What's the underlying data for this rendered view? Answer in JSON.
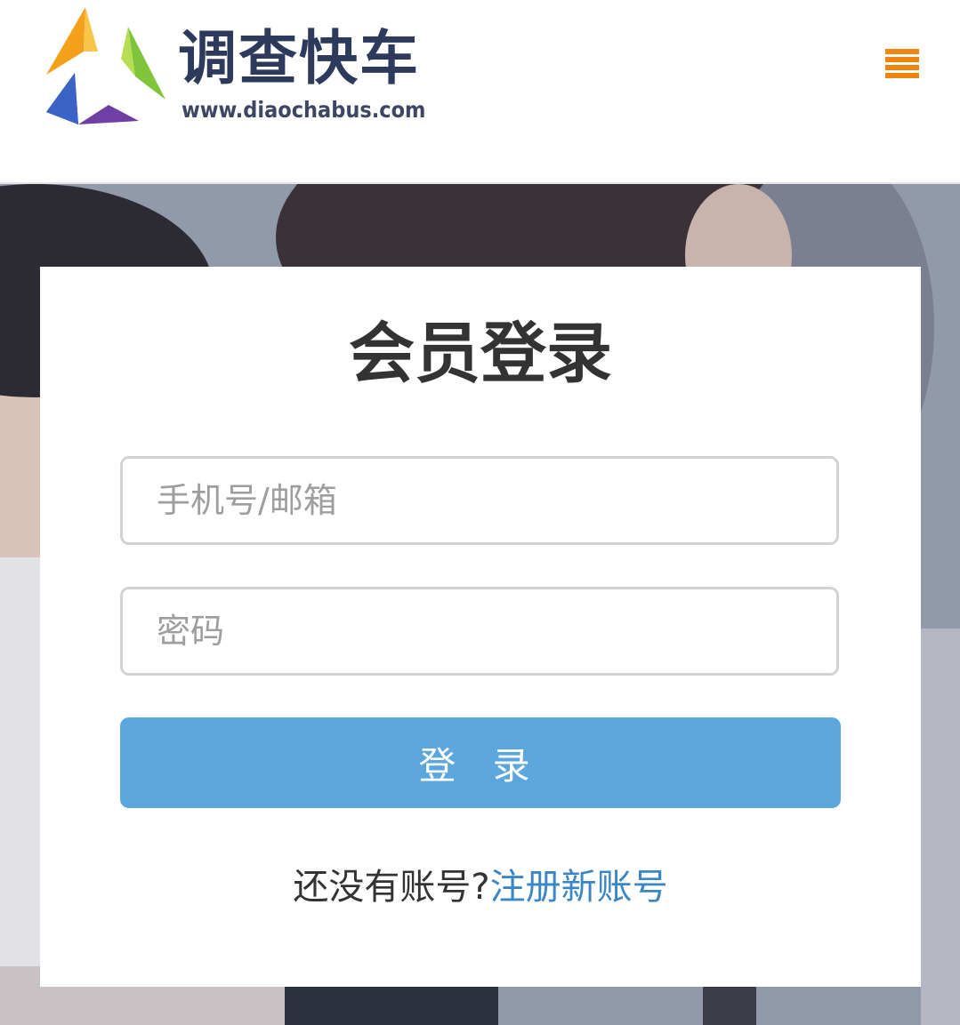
{
  "header": {
    "logo_title": "调查快车",
    "logo_url": "www.diaochabus.com",
    "menu_icon": "hamburger-menu-icon",
    "menu_color": "#f0860f"
  },
  "login_card": {
    "title": "会员登录",
    "account_placeholder": "手机号/邮箱",
    "password_placeholder": "密码",
    "login_button_label": "登 录",
    "register_prompt": "还没有账号?",
    "register_link": "注册新账号"
  },
  "colors": {
    "primary_button": "#5aa6dd",
    "link": "#3b86c4",
    "title_text": "#333333",
    "brand_text": "#2e3a5c"
  }
}
